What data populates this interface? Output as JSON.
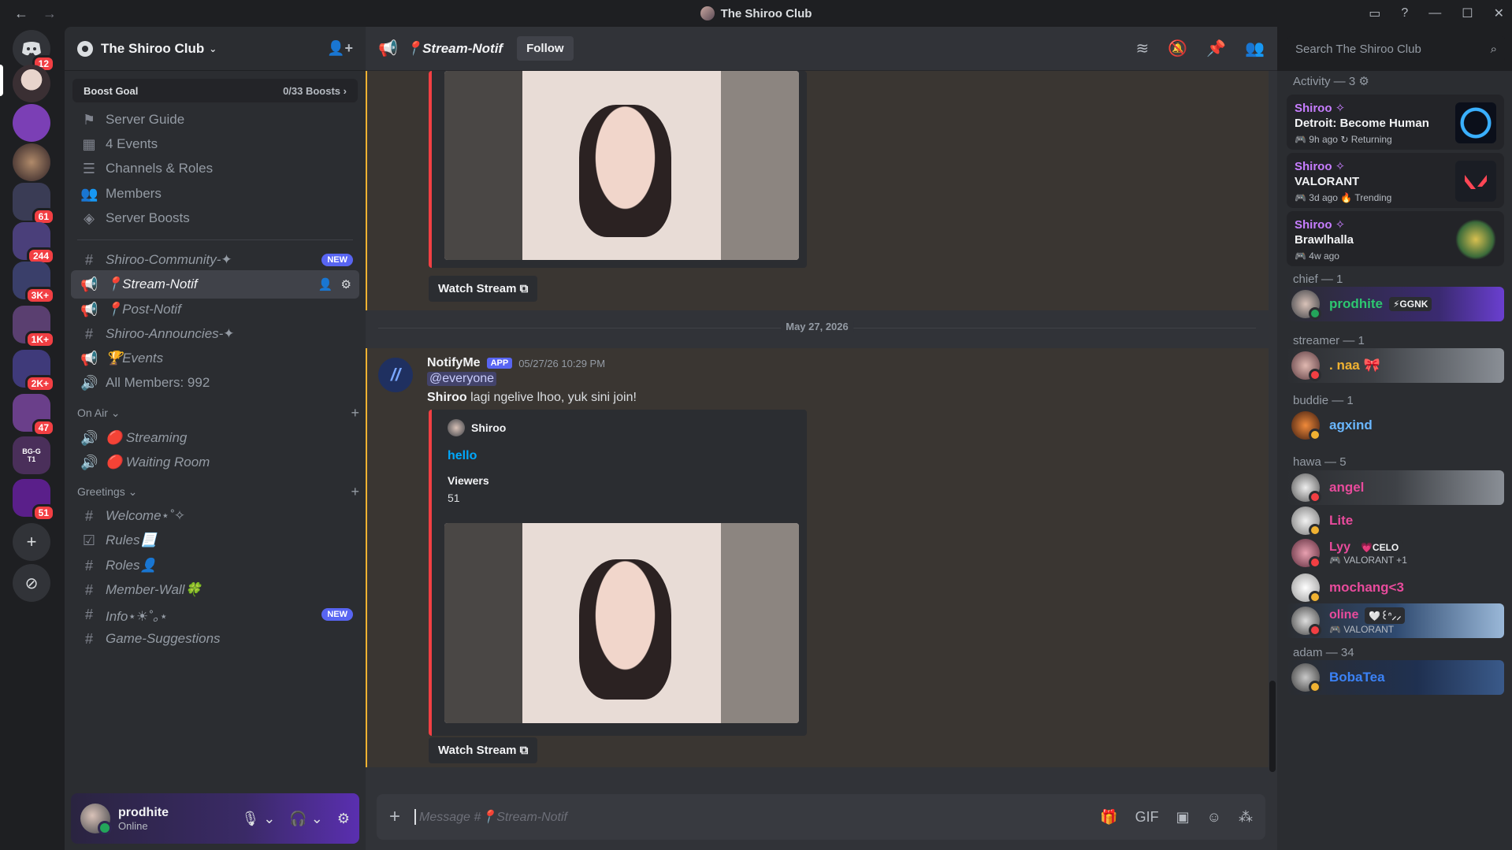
{
  "titlebar": {
    "title": "The Shiroo Club",
    "back": "←",
    "forward": "→",
    "inbox": "▭",
    "help": "?",
    "minimize": "—",
    "maximize": "☐",
    "close": "✕"
  },
  "rail": {
    "home_badge": "12",
    "guild_badges": [
      "61",
      "244",
      "3K+",
      "1K+",
      "2K+",
      "47",
      "51"
    ],
    "bgg_label": "BG-G",
    "t1_label": "T1"
  },
  "server": {
    "name": "The Shiroo Club",
    "boost_label": "Boost Goal",
    "boost_count": "0/33 Boosts",
    "nav": [
      {
        "icon": "⚑",
        "label": "Server Guide"
      },
      {
        "icon": "▦",
        "label": "4 Events"
      },
      {
        "icon": "☰",
        "label": "Channels & Roles"
      },
      {
        "icon": "👥",
        "label": "Members"
      },
      {
        "icon": "◈",
        "label": "Server Boosts"
      }
    ],
    "channels": [
      {
        "icon": "#",
        "label": "Shiroo-Community-✦",
        "badge": "NEW"
      },
      {
        "icon": "📢",
        "label": "📍Stream-Notif",
        "active": true
      },
      {
        "icon": "📢",
        "label": "📍Post-Notif"
      },
      {
        "icon": "#",
        "label": "Shiroo-Announcies-✦"
      },
      {
        "icon": "📢",
        "label": "🏆Events"
      },
      {
        "icon": "🔊",
        "label": "All Members: 992"
      }
    ],
    "cat_onair": "On Air",
    "onair": [
      {
        "icon": "🔊",
        "label": "🔴 Streaming"
      },
      {
        "icon": "🔊",
        "label": "🔴 Waiting Room"
      }
    ],
    "cat_greetings": "Greetings",
    "greetings": [
      {
        "icon": "#",
        "label": "Welcome⋆˚✧"
      },
      {
        "icon": "☑",
        "label": "Rules📃"
      },
      {
        "icon": "#",
        "label": "Roles👤"
      },
      {
        "icon": "#",
        "label": "Member-Wall🍀"
      },
      {
        "icon": "#",
        "label": "Info⋆☀︎˚｡⋆",
        "badge": "NEW"
      },
      {
        "icon": "#",
        "label": "Game-Suggestions"
      }
    ]
  },
  "user": {
    "name": "prodhite",
    "status": "Online"
  },
  "channel": {
    "name": "📍Stream-Notif",
    "follow": "Follow",
    "search_placeholder": "Search The Shiroo Club"
  },
  "messages": {
    "watch_stream": "Watch Stream",
    "date": "May 27, 2026",
    "author": "NotifyMe",
    "app_tag": "APP",
    "time": "05/27/26 10:29 PM",
    "mention": "@everyone",
    "text_bold": "Shiroo",
    "text_rest": " lagi ngelive lhoo, yuk sini join!",
    "embed_author": "Shiroo",
    "embed_title": "hello",
    "field_name": "Viewers",
    "field_value": "51"
  },
  "composer": {
    "placeholder": "Message #📍Stream-Notif"
  },
  "members": {
    "activity_header": "Activity — 3",
    "activities": [
      {
        "who": "Shiroo ✧",
        "game": "Detroit: Become Human",
        "meta": "🎮 9h ago  ↻ Returning"
      },
      {
        "who": "Shiroo ✧",
        "game": "VALORANT",
        "meta": "🎮 3d ago  🔥 Trending"
      },
      {
        "who": "Shiroo ✧",
        "game": "Brawlhalla",
        "meta": "🎮 4w ago"
      }
    ],
    "groups": [
      {
        "header": "chief — 1",
        "members": [
          {
            "name": "prodhite",
            "tag": "⚡GGNK",
            "color": "#2dc770"
          }
        ]
      },
      {
        "header": "streamer — 1",
        "members": [
          {
            "name": ". naa 🎀",
            "color": "#f0b232"
          }
        ]
      },
      {
        "header": "buddie — 1",
        "members": [
          {
            "name": "agxind",
            "color": "#6ab7ff"
          }
        ]
      },
      {
        "header": "hawa — 5",
        "members": [
          {
            "name": "angel",
            "color": "#e84b9c"
          },
          {
            "name": "Lite",
            "color": "#e84b9c"
          },
          {
            "name": "Lyy",
            "tag": "💗CELO",
            "sub": "🎮 VALORANT +1",
            "color": "#e84b9c"
          },
          {
            "name": "mochang<3",
            "color": "#e84b9c"
          },
          {
            "name": "oline",
            "tag": "🤍꒰ᐢ⸝⸝",
            "sub": "🎮 VALORANT",
            "color": "#e84b9c"
          }
        ]
      },
      {
        "header": "adam — 34",
        "members": [
          {
            "name": "BobaTea",
            "color": "#3b82f6"
          }
        ]
      }
    ]
  }
}
